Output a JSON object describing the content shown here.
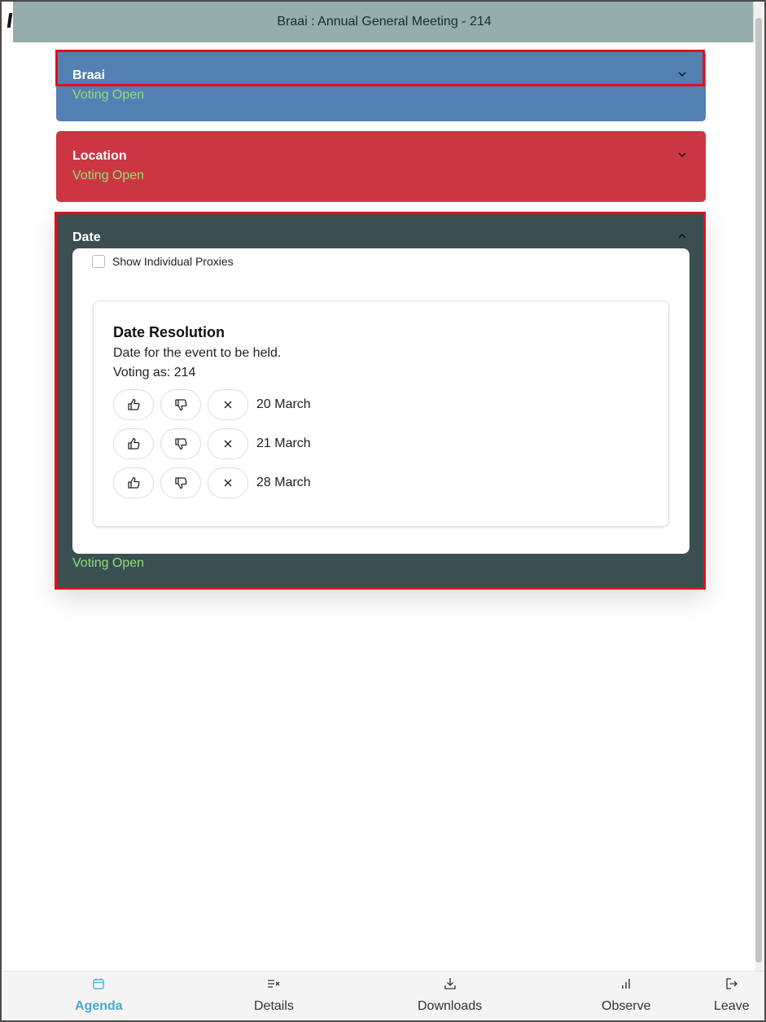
{
  "header": {
    "title": "Braai : Annual General Meeting - 214"
  },
  "agenda": [
    {
      "title": "Braai",
      "status": "Voting Open",
      "color": "#5380b2",
      "expanded": false
    },
    {
      "title": "Location",
      "status": "Voting Open",
      "color": "#cc3642",
      "expanded": false
    },
    {
      "title": "Date",
      "status": "Voting Open",
      "color": "#3b4e52",
      "expanded": true
    }
  ],
  "date_panel": {
    "proxy_label": "Show Individual Proxies",
    "resolution": {
      "title": "Date Resolution",
      "description": "Date for the event to be held.",
      "voting_as": "Voting as: 214",
      "options": [
        "20 March",
        "21 March",
        "28 March"
      ]
    }
  },
  "colors": {
    "status_green": "#8ee07a",
    "active_nav": "#4aa8d4",
    "focus_red": "#e0101a"
  },
  "nav": [
    {
      "label": "Agenda",
      "icon": "calendar-icon",
      "active": true
    },
    {
      "label": "Details",
      "icon": "list-x-icon",
      "active": false
    },
    {
      "label": "Downloads",
      "icon": "download-icon",
      "active": false
    },
    {
      "label": "Observe",
      "icon": "bar-chart-icon",
      "active": false
    },
    {
      "label": "Leave",
      "icon": "exit-icon",
      "active": false
    }
  ]
}
